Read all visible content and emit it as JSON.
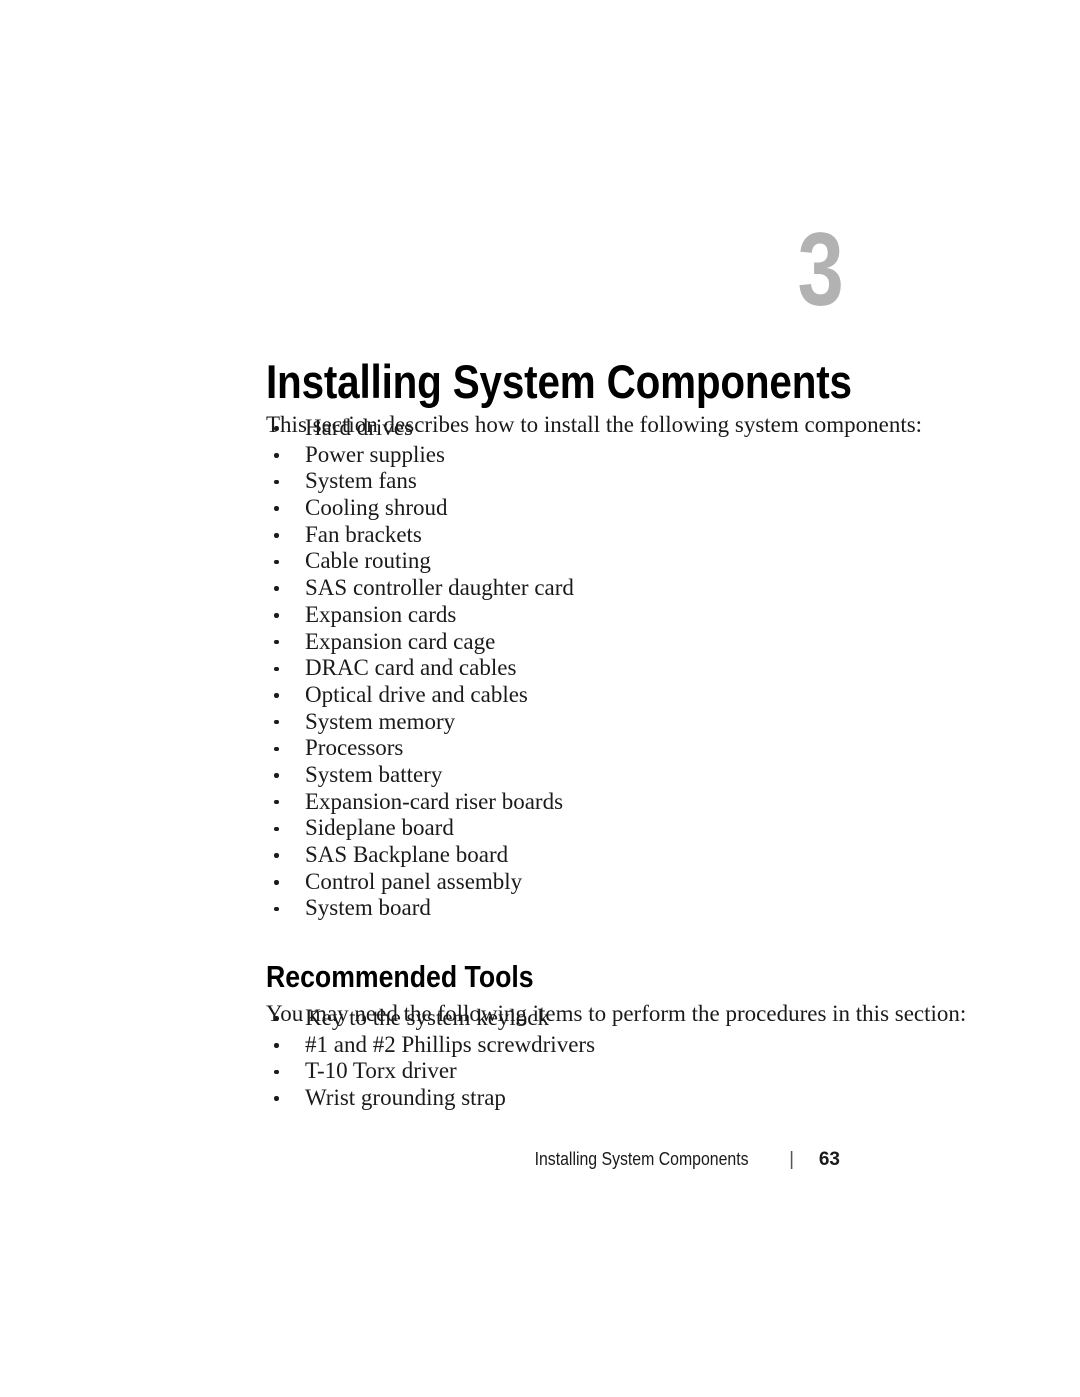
{
  "document": {
    "chapter_number": "3",
    "chapter_title": "Installing System Components",
    "intro_paragraph": "This section describes how to install the following system components:",
    "components_list": [
      "Hard drives",
      "Power supplies",
      "System fans",
      "Cooling shroud",
      "Fan brackets",
      "Cable routing",
      "SAS controller daughter card",
      "Expansion cards",
      "Expansion card cage",
      "DRAC card and cables",
      "Optical drive and cables",
      "System memory",
      "Processors",
      "System battery",
      "Expansion-card riser boards",
      "Sideplane board",
      "SAS Backplane board",
      "Control panel assembly",
      "System board"
    ],
    "recommended_tools_heading": "Recommended Tools",
    "tools_paragraph": "You may need the following items to perform the procedures in this section:",
    "tools_list": [
      "Key to the system keylock",
      "#1 and #2 Phillips screwdrivers",
      "T-10 Torx driver",
      "Wrist grounding strap"
    ]
  },
  "footer": {
    "title": "Installing System Components",
    "separator": "|",
    "page_number": "63"
  },
  "colors": {
    "page_background": "#ffffff",
    "body_text": "#1a1a1a",
    "heading_text": "#000000",
    "chapter_number": "#b2b2b2",
    "footer_separator": "#555555"
  }
}
